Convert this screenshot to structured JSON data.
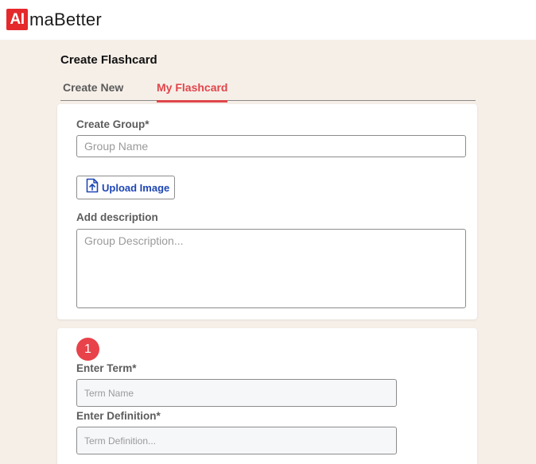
{
  "brand": {
    "logo_mark": "AI",
    "logo_text": "maBetter"
  },
  "page": {
    "title": "Create Flashcard"
  },
  "tabs": [
    {
      "label": "Create New",
      "active": false
    },
    {
      "label": "My Flashcard",
      "active": true
    }
  ],
  "group": {
    "label": "Create Group*",
    "name_placeholder": "Group Name",
    "upload_label": "Upload Image",
    "description_label": "Add description",
    "description_placeholder": "Group Description..."
  },
  "term_card": {
    "number": "1",
    "term_label": "Enter Term*",
    "term_placeholder": "Term Name",
    "definition_label": "Enter Definition*",
    "definition_placeholder": "Term Definition..."
  },
  "colors": {
    "accent": "#e0454a",
    "brand_red": "#e5282b",
    "upload_blue": "#1e46b4",
    "background": "#f6efe8"
  },
  "icons": {
    "upload": "file-upload-icon"
  }
}
